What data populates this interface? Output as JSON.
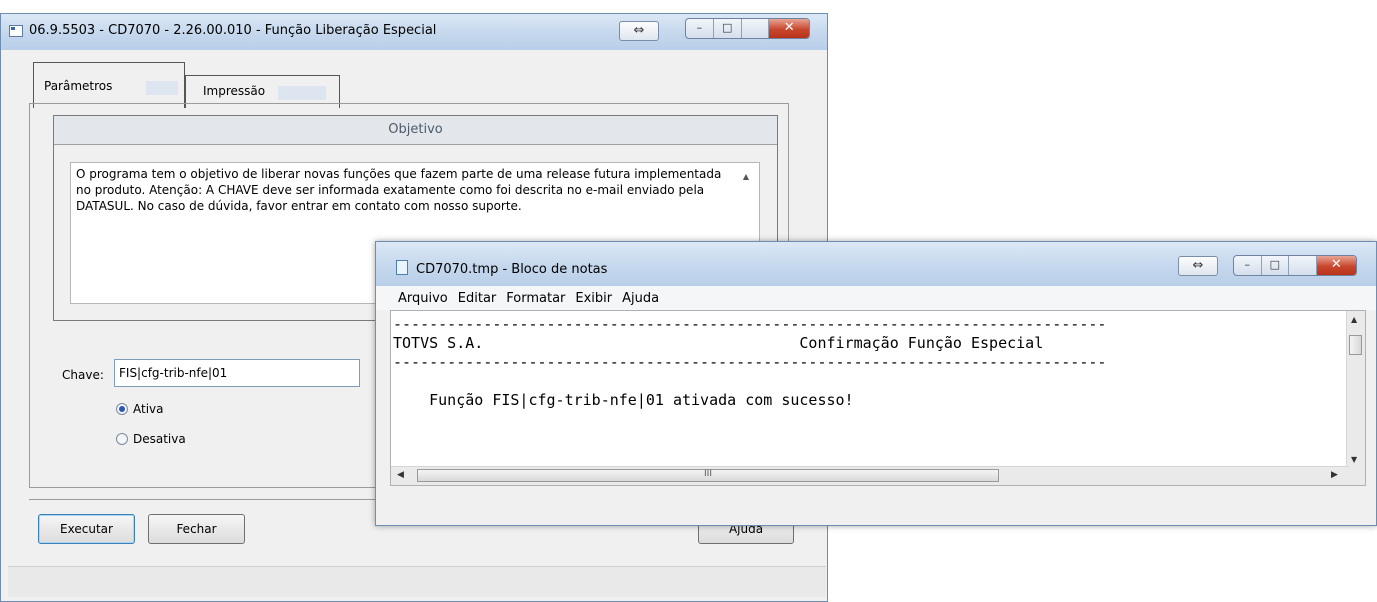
{
  "main_window": {
    "title": "06.9.5503 - CD7070 - 2.26.00.010 - Função Liberação Especial",
    "controls": {
      "swap": "⇔",
      "minimize": "–",
      "maximize": "□",
      "close": "✕"
    },
    "tabs": [
      {
        "label": "Parâmetros"
      },
      {
        "label": "Impressão"
      }
    ],
    "objetivo": {
      "header": "Objetivo",
      "text": "O programa tem o objetivo de liberar novas funções que fazem parte de uma release futura implementada no produto. Atenção: A CHAVE deve ser informada exatamente como foi descrita no e-mail enviado pela DATASUL. No caso de dúvida, favor entrar em contato com nosso suporte."
    },
    "chave": {
      "label": "Chave:",
      "value": "FIS|cfg-trib-nfe|01"
    },
    "radios": [
      {
        "label": "Ativa",
        "checked": true
      },
      {
        "label": "Desativa",
        "checked": false
      }
    ],
    "buttons": {
      "executar": "Executar",
      "fechar": "Fechar",
      "ajuda": "Ajuda"
    }
  },
  "notepad_window": {
    "title": "CD7070.tmp - Bloco de notas",
    "controls": {
      "swap": "⇔",
      "minimize": "–",
      "maximize": "□",
      "close": "✕"
    },
    "menu": [
      "Arquivo",
      "Editar",
      "Formatar",
      "Exibir",
      "Ajuda"
    ],
    "content": {
      "rule1": "-------------------------------------------------------------------------------",
      "company": "TOTVS S.A.",
      "heading": "Confirmação Função Especial",
      "rule2": "-------------------------------------------------------------------------------",
      "message": "Função FIS|cfg-trib-nfe|01 ativada com sucesso!"
    },
    "hscroll_grip": "III"
  },
  "colors": {
    "titlebar": "#c3d6ec",
    "close_button": "#c7472d",
    "window_bg": "#f0f0f0",
    "radio_selected": "#2a56b6"
  }
}
